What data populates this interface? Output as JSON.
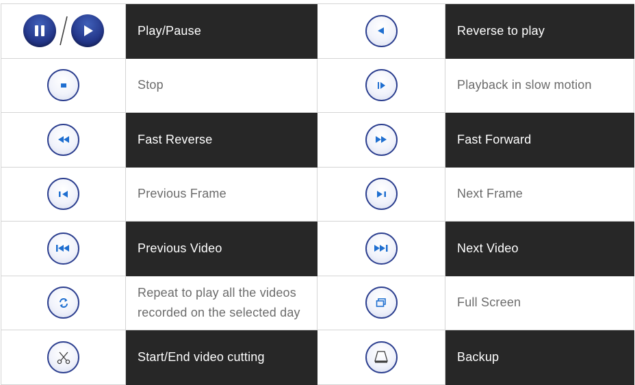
{
  "colors": {
    "dark_bg": "#272727",
    "accent_blue": "#2c3f8f",
    "icon_blue": "#1f6fd0",
    "grid_line": "#d4d4d4",
    "light_text": "#6b6b6b"
  },
  "rows": [
    {
      "left": {
        "icon": "play-pause-icon",
        "label": "Play/Pause"
      },
      "right": {
        "icon": "reverse-play-icon",
        "label": "Reverse to play"
      }
    },
    {
      "left": {
        "icon": "stop-icon",
        "label": "Stop"
      },
      "right": {
        "icon": "slow-motion-icon",
        "label": "Playback in slow motion"
      }
    },
    {
      "left": {
        "icon": "fast-reverse-icon",
        "label": "Fast Reverse"
      },
      "right": {
        "icon": "fast-forward-icon",
        "label": "Fast Forward"
      }
    },
    {
      "left": {
        "icon": "previous-frame-icon",
        "label": "Previous Frame"
      },
      "right": {
        "icon": "next-frame-icon",
        "label": "Next Frame"
      }
    },
    {
      "left": {
        "icon": "previous-video-icon",
        "label": "Previous Video"
      },
      "right": {
        "icon": "next-video-icon",
        "label": "Next Video"
      }
    },
    {
      "left": {
        "icon": "repeat-icon",
        "label": "Repeat to play all the videos\nrecorded on the selected day"
      },
      "right": {
        "icon": "full-screen-icon",
        "label": "Full Screen"
      }
    },
    {
      "left": {
        "icon": "scissors-icon",
        "label": "Start/End video cutting"
      },
      "right": {
        "icon": "backup-icon",
        "label": "Backup"
      }
    }
  ]
}
